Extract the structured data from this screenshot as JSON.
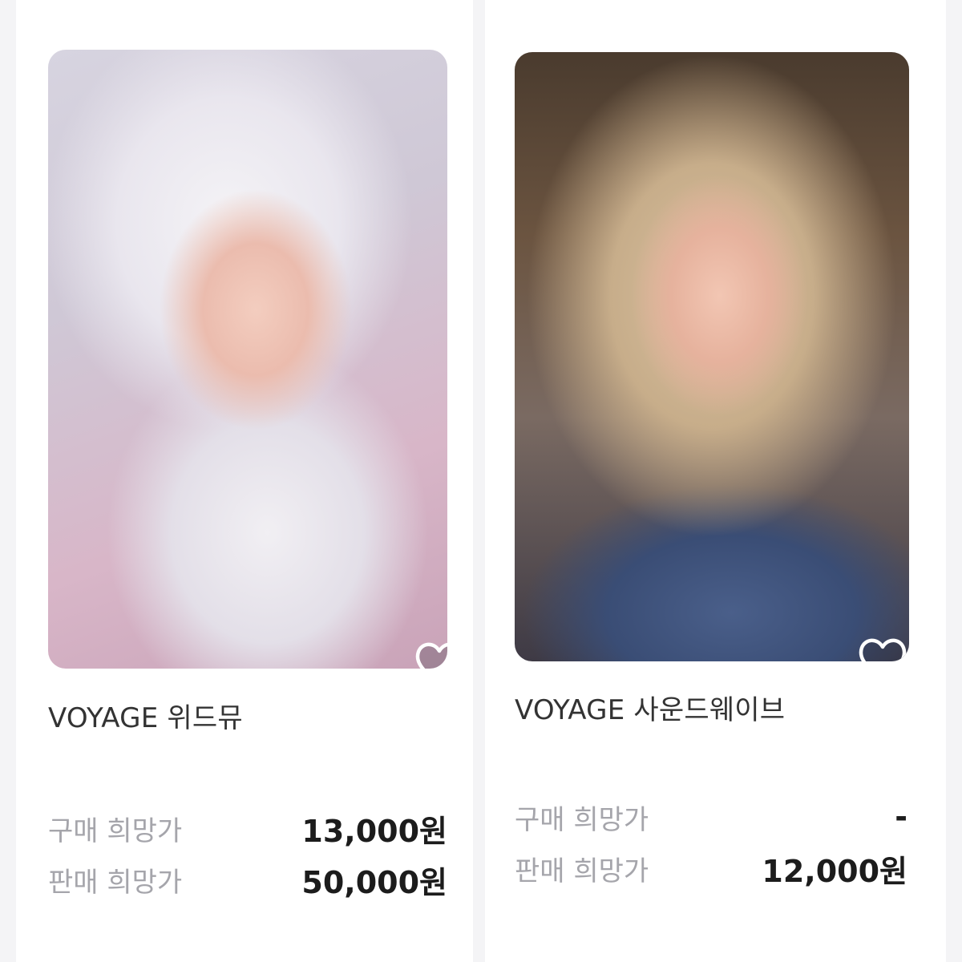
{
  "products": [
    {
      "title": "VOYAGE 위드뮤",
      "buy_label": "구매 희망가",
      "buy_price": "13,000원",
      "sell_label": "판매 희망가",
      "sell_price": "50,000원",
      "favorite_icon": "heart-outline-icon"
    },
    {
      "title": "VOYAGE 사운드웨이브",
      "buy_label": "구매 희망가",
      "buy_price": "-",
      "sell_label": "판매 희망가",
      "sell_price": "12,000원",
      "favorite_icon": "heart-outline-icon"
    }
  ],
  "colors": {
    "label_gray": "#a5a5ab",
    "price_dark": "#1c1c1c",
    "title_dark": "#333333",
    "card_bg": "#ffffff",
    "page_bg": "#f4f4f6"
  }
}
